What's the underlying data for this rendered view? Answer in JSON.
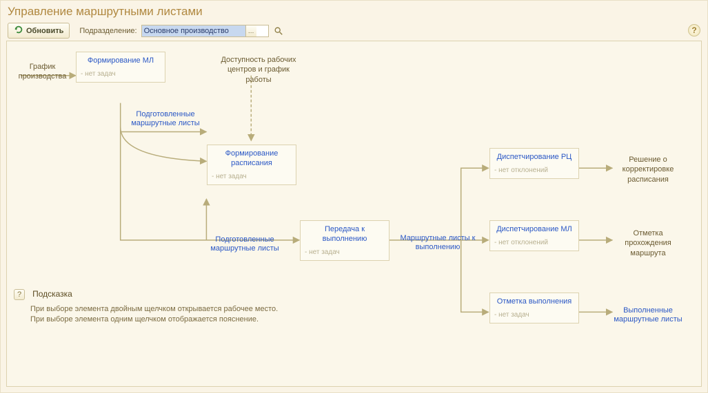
{
  "title": "Управление маршрутными листами",
  "toolbar": {
    "refresh_label": "Обновить",
    "subdivision_label": "Подразделение:",
    "subdivision_value": "Основное производство"
  },
  "labels": {
    "input_graph": "График производства",
    "availability": "Доступность рабочих центров и график работы",
    "decision": "Решение о корректировке расписания",
    "route_mark": "Отметка прохождения маршрута",
    "completed": "Выполненные маршрутные листы"
  },
  "edges": {
    "prepared1": "Подготовленные маршрутные листы",
    "prepared2": "Подготовленные маршрутные листы",
    "to_exec": "Маршрутные листы к выполнению"
  },
  "nodes": {
    "form_ml": {
      "title": "Формирование МЛ",
      "sub": "- нет задач"
    },
    "form_sched": {
      "title": "Формирование расписания",
      "sub": "- нет задач"
    },
    "transfer": {
      "title": "Передача к выполнению",
      "sub": "- нет задач"
    },
    "disp_rc": {
      "title": "Диспетчирование РЦ",
      "sub": "- нет отклонений"
    },
    "disp_ml": {
      "title": "Диспетчирование МЛ",
      "sub": "- нет отклонений"
    },
    "mark_done": {
      "title": "Отметка выполнения",
      "sub": "- нет задач"
    }
  },
  "hint": {
    "title": "Подсказка",
    "line1": "При выборе элемента двойным щелчком открывается рабочее место.",
    "line2": "При выборе элемента одним щелчком отображается пояснение."
  }
}
